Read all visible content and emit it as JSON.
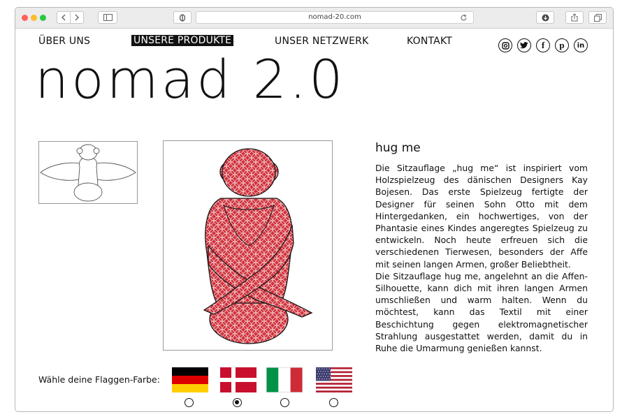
{
  "browser": {
    "url": "nomad-20.com",
    "traffic_lights": {
      "close": "#ff5f57",
      "minimize": "#febc2e",
      "zoom": "#28c840"
    }
  },
  "nav": {
    "items": [
      {
        "label": "ÜBER UNS",
        "active": false
      },
      {
        "label": "UNSERE PRODUKTE",
        "active": true
      },
      {
        "label": "UNSER NETZWERK",
        "active": false
      },
      {
        "label": "KONTAKT",
        "active": false
      }
    ],
    "social_icons": [
      "instagram-icon",
      "twitter-icon",
      "facebook-icon",
      "pinterest-icon",
      "linkedin-icon"
    ]
  },
  "brand": {
    "logo": "nomad 2.0"
  },
  "product": {
    "title": "hug me",
    "paragraph1": "Die Sitzauflage „hug me“ ist inspiriert vom Holzspielzeug des dänischen Designers Kay Bojesen. Das erste Spielzeug fertigte der Designer für seinen Sohn Otto mit dem Hintergedanken, ein hochwertiges, von der Phantasie eines Kindes angeregtes Spielzeug zu entwickeln. Noch heute erfreuen sich die verschiedenen Tierwesen, besonders der Affe mit seinen langen Armen, großer Beliebtheit.",
    "paragraph2": "Die Sitzauflage hug me, angelehnt an die Affen-Silhouette, kann dich mit ihren langen Armen umschließen und warm halten. Wenn du möchtest, kann das Textil mit einer Beschichtung gegen elektromagnetischer Strahlung ausgestattet werden, damit du in Ruhe die Umarmung genießen kannst.",
    "fabric_color": "#d0313b"
  },
  "flags": {
    "label": "Wähle deine Flaggen-Farbe:",
    "options": [
      {
        "name": "germany",
        "selected": false
      },
      {
        "name": "denmark",
        "selected": true
      },
      {
        "name": "italy",
        "selected": false
      },
      {
        "name": "usa",
        "selected": false
      }
    ]
  }
}
